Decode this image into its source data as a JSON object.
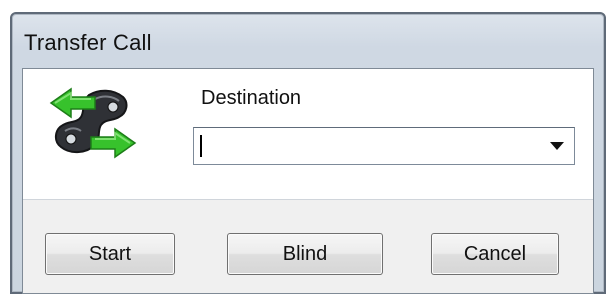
{
  "window": {
    "title": "Transfer Call"
  },
  "form": {
    "destination_label": "Destination",
    "destination_value": "",
    "destination_placeholder": ""
  },
  "buttons": {
    "start_label": "Start",
    "blind_label": "Blind",
    "cancel_label": "Cancel"
  },
  "icons": {
    "transfer": "phone-transfer-icon",
    "dropdown": "chevron-down-icon"
  },
  "colors": {
    "frame": "#5f6a78",
    "client_border": "#7f8a96",
    "arrow_green": "#3fbf2f",
    "phone_dark": "#2d2f33"
  }
}
